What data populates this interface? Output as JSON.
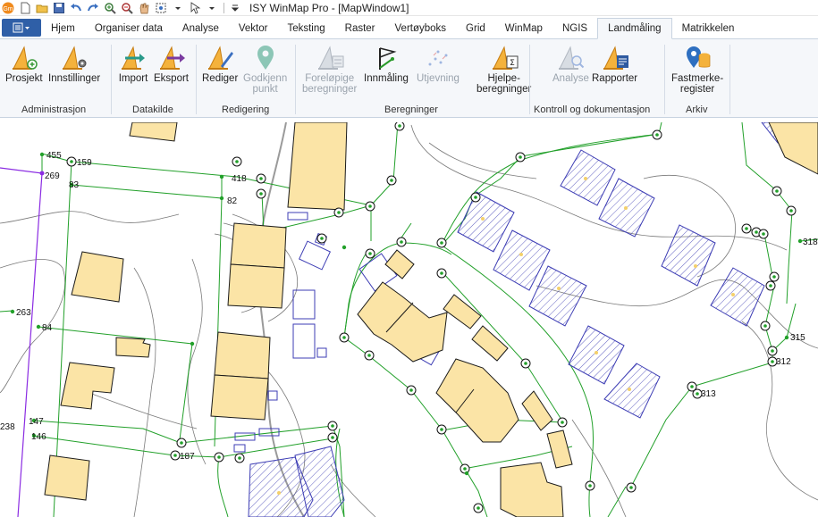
{
  "window": {
    "title": "ISY WinMap Pro - [MapWindow1]"
  },
  "quick_access": [
    {
      "name": "app-logo-icon"
    },
    {
      "name": "new-file-icon"
    },
    {
      "name": "open-folder-icon"
    },
    {
      "name": "save-icon"
    },
    {
      "name": "undo-icon"
    },
    {
      "name": "redo-icon"
    },
    {
      "name": "zoom-in-icon"
    },
    {
      "name": "zoom-out-icon"
    },
    {
      "name": "pan-hand-icon"
    },
    {
      "name": "zoom-extent-icon"
    },
    {
      "name": "select-pointer-icon"
    }
  ],
  "tabs": [
    "Hjem",
    "Organiser data",
    "Analyse",
    "Vektor",
    "Teksting",
    "Raster",
    "Vertøyboks",
    "Grid",
    "WinMap",
    "NGIS",
    "Landmåling",
    "Matrikkelen"
  ],
  "active_tab": "Landmåling",
  "ribbon": {
    "groups": [
      {
        "label": "Administrasjon"
      },
      {
        "label": "Datakilde"
      },
      {
        "label": "Redigering"
      },
      {
        "label": "Beregninger"
      },
      {
        "label": "Kontroll og dokumentasjon"
      },
      {
        "label": "Arkiv"
      }
    ],
    "buttons": [
      {
        "label": "Prosjekt",
        "icon": "project-icon",
        "enabled": true
      },
      {
        "label": "Innstillinger",
        "icon": "settings-icon",
        "enabled": true
      },
      {
        "label": "Import",
        "icon": "import-icon",
        "enabled": true
      },
      {
        "label": "Eksport",
        "icon": "export-icon",
        "enabled": true
      },
      {
        "label": "Rediger",
        "icon": "edit-icon",
        "enabled": true
      },
      {
        "label": "Godkjenn\npunkt",
        "icon": "approve-point-icon",
        "enabled": false
      },
      {
        "label": "Foreløpige\nberegninger",
        "icon": "preliminary-calc-icon",
        "enabled": false
      },
      {
        "label": "Innmåling",
        "icon": "survey-icon",
        "enabled": true
      },
      {
        "label": "Utjevning",
        "icon": "adjustment-icon",
        "enabled": false
      },
      {
        "label": "Hjelpe-\nberegninger",
        "icon": "helper-calc-icon",
        "enabled": true
      },
      {
        "label": "Analyse",
        "icon": "analysis-icon",
        "enabled": false
      },
      {
        "label": "Rapporter",
        "icon": "reports-icon",
        "enabled": true
      },
      {
        "label": "Fastmerke-\nregister",
        "icon": "fixed-mark-register-icon",
        "enabled": true
      }
    ]
  },
  "map": {
    "point_labels": [
      "455",
      "159",
      "269",
      "83",
      "418",
      "82",
      "263",
      "84",
      "147",
      "238",
      "146",
      "187",
      "318",
      "315",
      "312",
      "313"
    ],
    "colors": {
      "building_fill": "#fbe4a6",
      "building_stroke": "#1a1a1a",
      "boundary": "#22a02a",
      "planned_building": "#3c3cb4",
      "contour": "#7a7a7a",
      "road": "#9a9a9a",
      "purple_line": "#8a2be2"
    }
  }
}
